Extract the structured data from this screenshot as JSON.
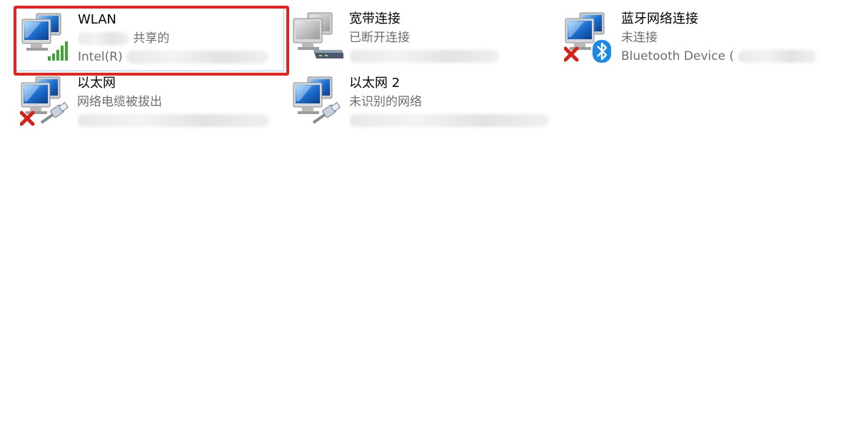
{
  "connections": [
    {
      "name": "WLAN",
      "status_suffix": "共享的",
      "device_prefix": "Intel(R)",
      "selected": true,
      "icon": "wifi-signal-icon",
      "badge": "none"
    },
    {
      "name": "宽带连接",
      "status": "已断开连接",
      "device_prefix": "",
      "icon": "modem-icon",
      "badge": "none"
    },
    {
      "name": "蓝牙网络连接",
      "status": "未连接",
      "device_prefix": "Bluetooth Device (",
      "icon": "bluetooth-icon",
      "badge": "disconnected-x-icon"
    },
    {
      "name": "以太网",
      "status": "网络电缆被拔出",
      "device_prefix": "",
      "icon": "ethernet-cable-icon",
      "badge": "disconnected-x-icon"
    },
    {
      "name": "以太网 2",
      "status": "未识别的网络",
      "device_prefix": "",
      "icon": "ethernet-cable-icon",
      "badge": "none"
    }
  ],
  "colors": {
    "highlight": "#e8231f",
    "selection_border": "#99d1ff",
    "name_text": "#000000",
    "secondary_text": "#6d6d6d",
    "monitor_blue": "#1c6fd1",
    "bluetooth_blue": "#1e88e5",
    "error_red": "#d6201a",
    "signal_green": "#3fa535"
  }
}
